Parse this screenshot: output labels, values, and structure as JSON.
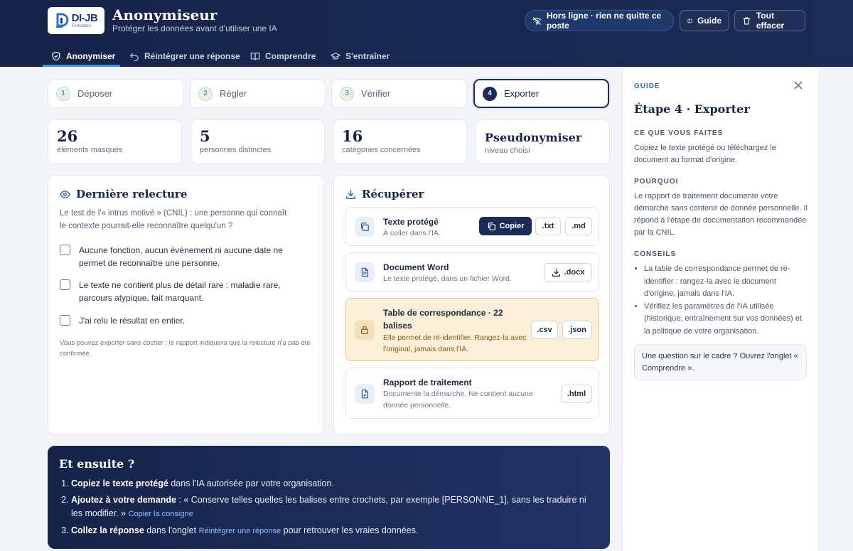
{
  "header": {
    "logo_text": "DI-JB",
    "logo_sub": "Formation",
    "title": "Anonymiseur",
    "subtitle": "Protéger les données avant d'utiliser une IA",
    "offline_label": "Hors ligne · rien ne quitte ce poste",
    "guide_label": "Guide",
    "clear_label": "Tout effacer"
  },
  "nav": {
    "tabs": [
      {
        "label": "Anonymiser",
        "icon": "shield-icon",
        "active": true
      },
      {
        "label": "Réintégrer une réponse",
        "icon": "undo-arrow-icon"
      },
      {
        "label": "Comprendre",
        "icon": "book-icon"
      },
      {
        "label": "S'entraîner",
        "icon": "graduation-cap-icon"
      }
    ]
  },
  "steps": [
    {
      "num": "1",
      "label": "Déposer"
    },
    {
      "num": "2",
      "label": "Régler"
    },
    {
      "num": "3",
      "label": "Vérifier"
    },
    {
      "num": "4",
      "label": "Exporter",
      "active": true
    }
  ],
  "stats": [
    {
      "value": "26",
      "label": "éléments masqués"
    },
    {
      "value": "5",
      "label": "personnes distinctes"
    },
    {
      "value": "16",
      "label": "catégories concernées"
    },
    {
      "value": "Pseudonymiser",
      "label": "niveau choisi"
    }
  ],
  "review": {
    "title": "Dernière relecture",
    "intro": "Le test de l'« intrus motivé » (CNIL) : une personne qui connaît le contexte pourrait-elle reconnaître quelqu'un ?",
    "checks": [
      "Aucune fonction, aucun événement ni aucune date ne permet de reconnaître une personne.",
      "Le texte ne contient plus de détail rare : maladie rare, parcours atypique, fait marquant.",
      "J'ai relu le résultat en entier."
    ],
    "note": "Vous pouvez exporter sans cocher : le rapport indiquera que la relecture n'a pas été confirmée."
  },
  "export": {
    "title": "Récupérer",
    "rows": [
      {
        "title": "Texte protégé",
        "desc": "À coller dans l'IA.",
        "buttons": [
          "Copier",
          ".txt",
          ".md"
        ]
      },
      {
        "title": "Document Word",
        "desc": "Le texte protégé, dans un fichier Word.",
        "buttons": [
          ".docx"
        ]
      },
      {
        "title_line1": "Table de correspondance · 22",
        "title_line2": "balises",
        "desc_line1": "Elle permet de ré-identifier. Rangez-la avec",
        "desc_line2": "l'original, jamais dans l'IA.",
        "buttons": [
          ".csv",
          ".json"
        ]
      },
      {
        "title": "Rapport de traitement",
        "desc_line1": "Documente la démarche. Ne contient aucune",
        "desc_line2": "donnée personnelle.",
        "buttons": [
          ".html"
        ]
      }
    ]
  },
  "next": {
    "title": "Et ensuite ?",
    "step1_bold": "Copiez le texte protégé",
    "step1_rest": " dans l'IA autorisée par votre organisation.",
    "step2_bold": "Ajoutez à votre demande",
    "step2_rest": " : « Conserve telles quelles les balises entre crochets, par exemple [PERSONNE_1], sans les traduire ni les modifier. » ",
    "step2_link": "Copier la consigne",
    "step3_bold": "Collez la réponse",
    "step3_mid": " dans l'onglet ",
    "step3_link": "Réintégrer une réponse",
    "step3_rest": " pour retrouver les vraies données."
  },
  "guide": {
    "kicker": "GUIDE",
    "title": "Étape 4 · Exporter",
    "h1": "CE QUE VOUS FAITES",
    "p1": "Copiez le texte protégé ou téléchargez le document au format d'origine.",
    "h2": "POURQUOI",
    "p2": "Le rapport de traitement documente votre démarche sans contenir de donnée personnelle. Il répond à l'étape de documentation recommandée par la CNIL.",
    "h3": "CONSEILS",
    "tips": [
      "La table de correspondance permet de ré-identifier : rangez-la avec le document d'origine, jamais dans l'IA.",
      "Vérifiez les paramètres de l'IA utilisée (historique, entraînement sur vos données) et la politique de votre organisation."
    ],
    "box": "Une question sur le cadre ? Ouvrez l'onglet « Comprendre »."
  },
  "colors": {
    "navy": "#16244a",
    "accent_blue": "#4a8be6",
    "warn_bg": "#fcefd7",
    "step_done": "#e4f4ea"
  }
}
